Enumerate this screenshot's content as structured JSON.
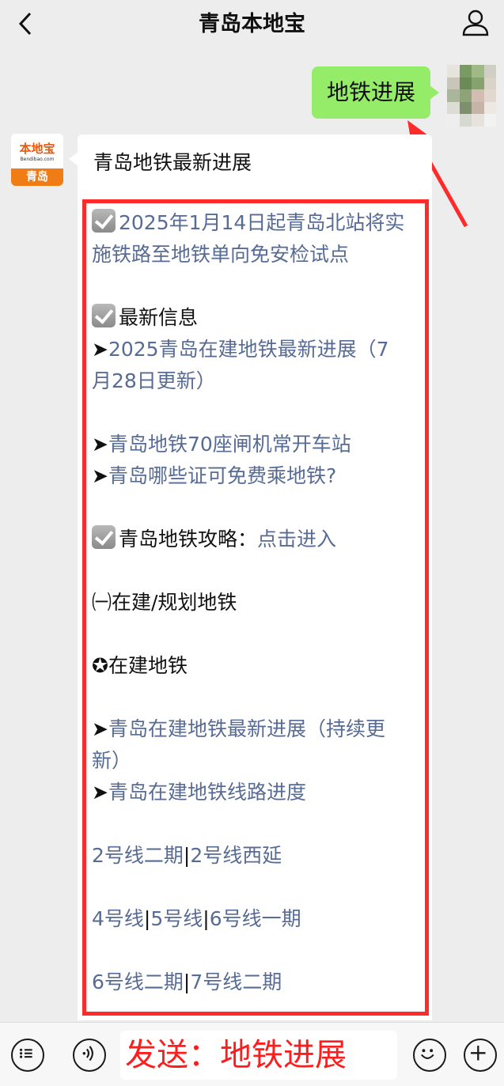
{
  "header": {
    "title": "青岛本地宝",
    "back_icon": "chevron-left-icon",
    "profile_icon": "user-icon"
  },
  "user_message": {
    "text": "地铁进展"
  },
  "bot": {
    "avatar_logo": "本地宝",
    "avatar_url": "Bendibao.com",
    "avatar_city": "青岛",
    "title": "青岛地铁最新进展",
    "lines": {
      "l1": "2025年1月14日起青岛北站将实施铁路至地铁单向免安检试点",
      "l2": "最新信息",
      "l3": "2025青岛在建地铁最新进展（7月28日更新）",
      "l4": "青岛地铁70座闸机常开车站",
      "l5": "青岛哪些证可免费乘地铁?",
      "l6a": "青岛地铁攻略：",
      "l6b": "点击进入",
      "l7": "㈠在建/规划地铁",
      "l8": "✪在建地铁",
      "l9": "青岛在建地铁最新进展（持续更新）",
      "l10": "青岛在建地铁线路进度",
      "l11a": "2号线二期",
      "l11b": "2号线西延",
      "l12a": "4号线",
      "l12b": "5号线",
      "l12c": "6号线一期",
      "l13a": "6号线二期",
      "l13b": "7号线二期",
      "arrow": "➤",
      "sep": "|"
    }
  },
  "input": {
    "text": "发送：地铁进展"
  },
  "colors": {
    "bubble_green": "#95ec69",
    "link": "#576b95",
    "annotation_red": "#ff2b2b",
    "brand_orange": "#f07c16"
  }
}
